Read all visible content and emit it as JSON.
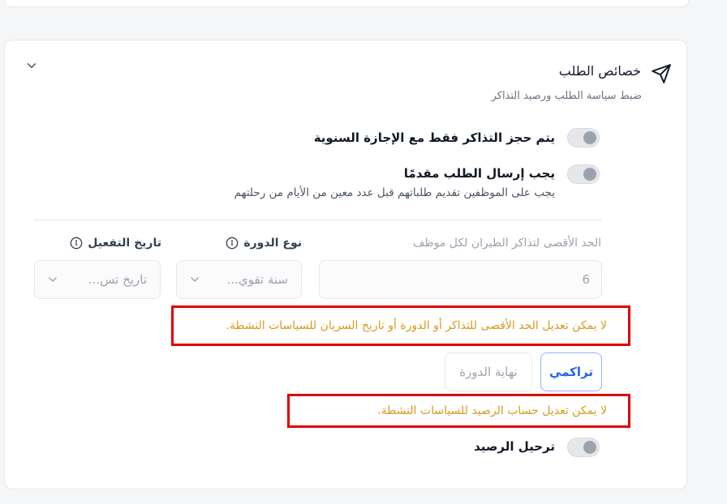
{
  "section": {
    "title": "خصائص الطلب",
    "subtitle": "ضبط سياسة الطلب ورصيد التذاكر",
    "icon": "send-icon",
    "collapse_icon": "chevron-down-icon"
  },
  "toggles": {
    "annual_leave_only": {
      "label": "يتم حجز التذاكر فقط مع الإجازة السنوية",
      "enabled": false
    },
    "advance_request": {
      "label": "يجب إرسال الطلب مقدمًا",
      "description": "يجب على الموظفين تقديم طلباتهم قبل عدد معين من الأيام من رحلتهم",
      "enabled": false
    },
    "balance_carryover": {
      "label": "ترحيل الرصيد",
      "enabled": false
    }
  },
  "fields": {
    "max_tickets": {
      "label": "الحد الأقصى لتذاكر الطيران لكل موظف",
      "value": "6"
    },
    "cycle_type": {
      "label": "نوع الدورة",
      "value": "سنة تقوي..."
    },
    "activation_date": {
      "label": "تاريخ التفعيل",
      "value": "تاريخ تس..."
    }
  },
  "warnings": {
    "locked_policy": "لا يمكن تعديل الحد الأقصى للتذاكر أو الدورة أو تاريخ السريان للسياسات النشطة.",
    "locked_balance": "لا يمكن تعديل حساب الرصيد للسياسات النشطة."
  },
  "balance_mode": {
    "options": [
      "تراكمي",
      "نهاية الدورة"
    ],
    "selected": "تراكمي"
  },
  "colors": {
    "warning_text": "#d99a1e",
    "highlight_border": "#e00000",
    "active_accent": "#2563eb"
  }
}
